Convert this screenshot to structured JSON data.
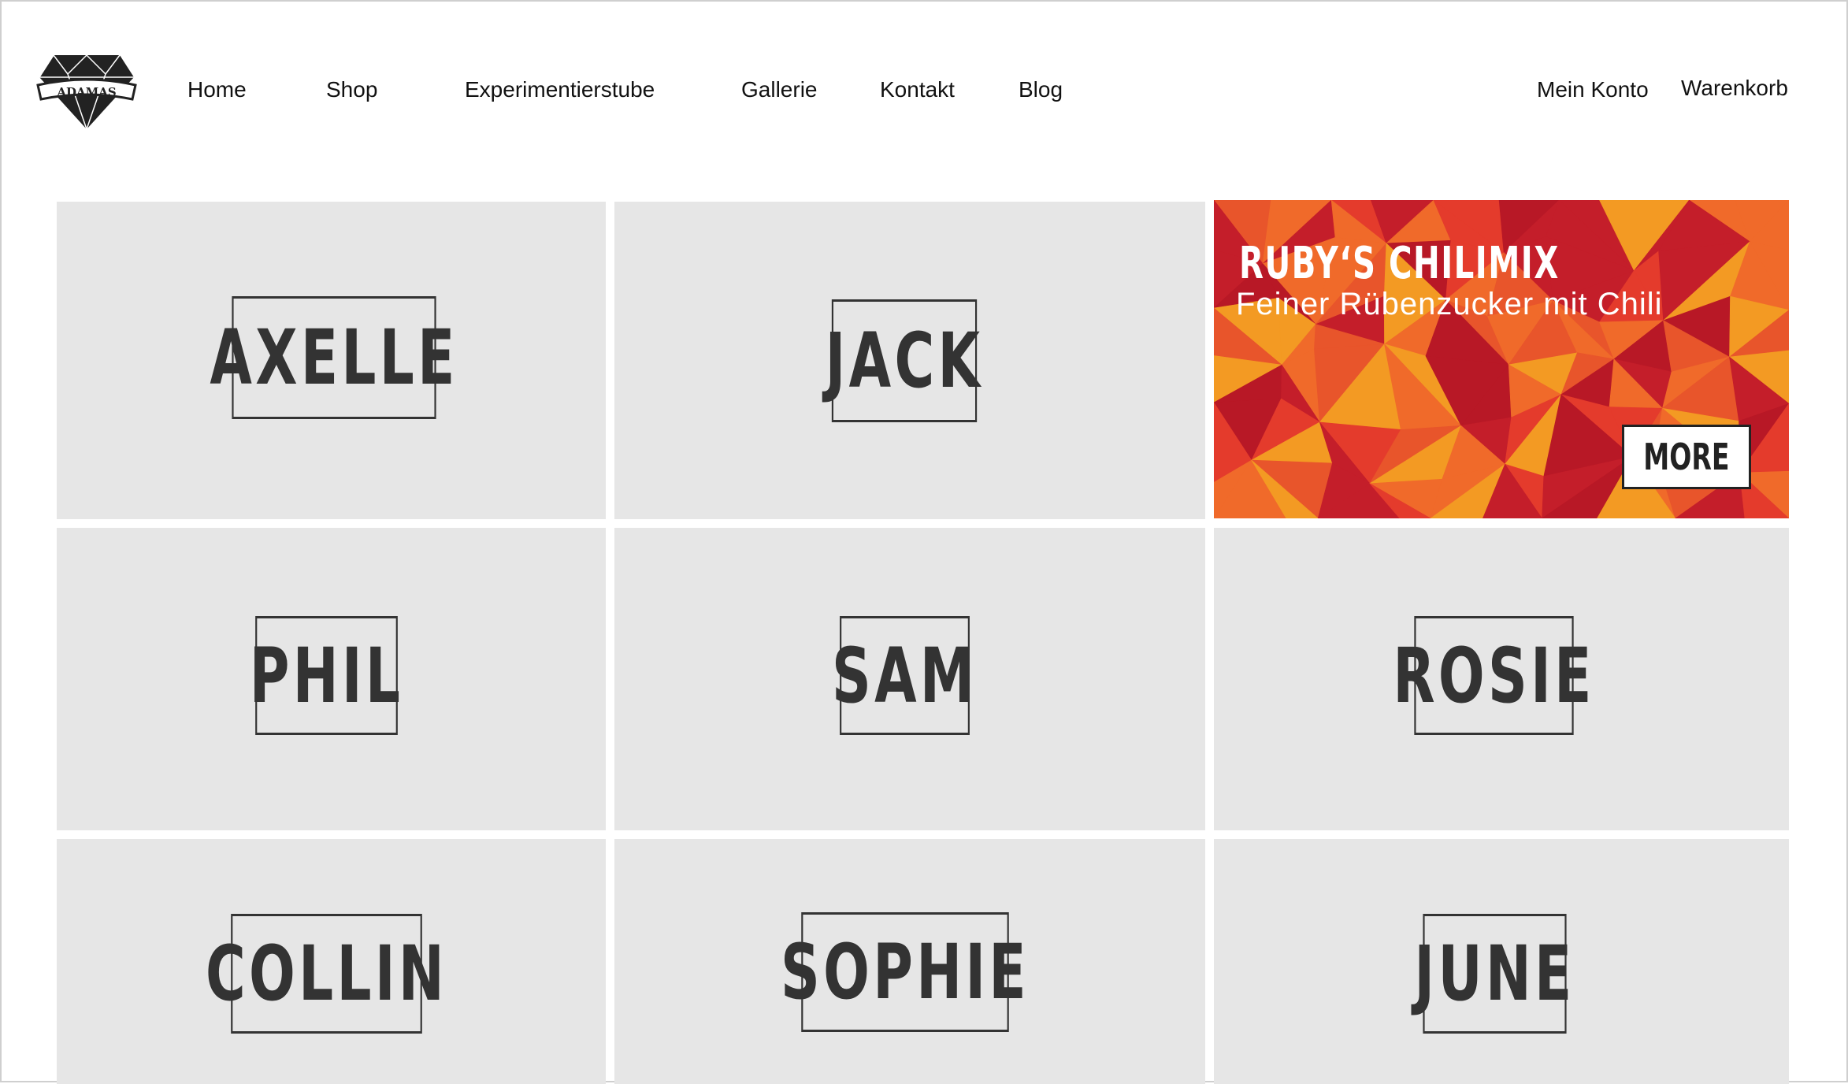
{
  "brand": {
    "logo_text": "ADAMAS"
  },
  "nav": {
    "items": [
      "Home",
      "Shop",
      "Experimentierstube",
      "Gallerie",
      "Kontakt",
      "Blog"
    ],
    "account": "Mein Konto",
    "cart": "Warenkorb"
  },
  "tiles": {
    "axelle": "AXELLE",
    "jack": "JACK",
    "phil": "PHIL",
    "sam": "SAM",
    "rosie": "ROSIE",
    "collin": "COLLIN",
    "sophie": "SOPHIE",
    "june": "JUNE"
  },
  "promo": {
    "title": "RUBY‘S CHILIMIX",
    "subtitle": "Feiner Rübenzucker mit Chili",
    "button": "MORE"
  },
  "colors": {
    "tile_bg": "#e6e6e6",
    "text_dark": "#333333",
    "promo_palette": [
      "#c41e2a",
      "#e43b2c",
      "#f06a2a",
      "#f39a23",
      "#b81826",
      "#e8552b"
    ]
  }
}
